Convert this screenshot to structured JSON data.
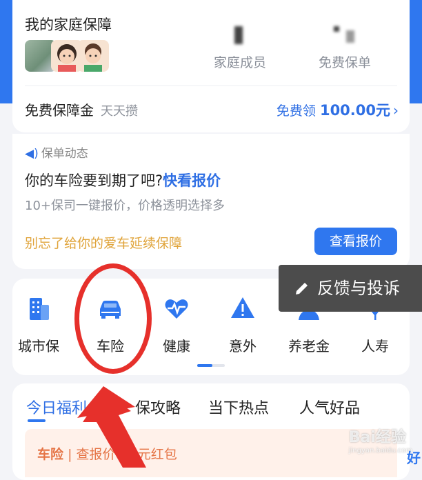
{
  "family": {
    "title": "我的家庭保障",
    "stats": [
      {
        "label": "家庭成员"
      },
      {
        "label": "免费保单"
      }
    ],
    "fund_label": "免费保障金",
    "fund_sub": "天天攒",
    "fund_link_prefix": "免费领",
    "fund_amount": "100.00",
    "fund_unit": "元"
  },
  "news": {
    "header": "保单动态",
    "title_prefix": "你的车险要到期了吧?",
    "title_link": "快看报价",
    "subtitle": "10+保司一键报价，价格透明选择多",
    "reminder": "别忘了给你的爱车延续保障",
    "button": "查看报价"
  },
  "categories": [
    {
      "label": "城市保",
      "icon": "building-icon"
    },
    {
      "label": "车险",
      "icon": "car-icon"
    },
    {
      "label": "健康",
      "icon": "heart-pulse-icon"
    },
    {
      "label": "意外",
      "icon": "warning-icon"
    },
    {
      "label": "养老金",
      "icon": "person-icon"
    },
    {
      "label": "人寿",
      "icon": "leaf-icon"
    }
  ],
  "feedback": {
    "label": "反馈与投诉",
    "icon": "pencil-icon"
  },
  "tabs": [
    "今日福利",
    "保攻略",
    "当下热点",
    "人气好品"
  ],
  "promo": {
    "tag": "车险",
    "text": "| 查报价",
    "text_end": "99元红包"
  },
  "watermark": {
    "brand": "Bai",
    "suffix": "经验",
    "url": "jingyan.baidu.com"
  },
  "right_cut": "好",
  "colors": {
    "accent": "#2f77ef",
    "annotation": "#e6302b",
    "reminder": "#e0a43b"
  }
}
